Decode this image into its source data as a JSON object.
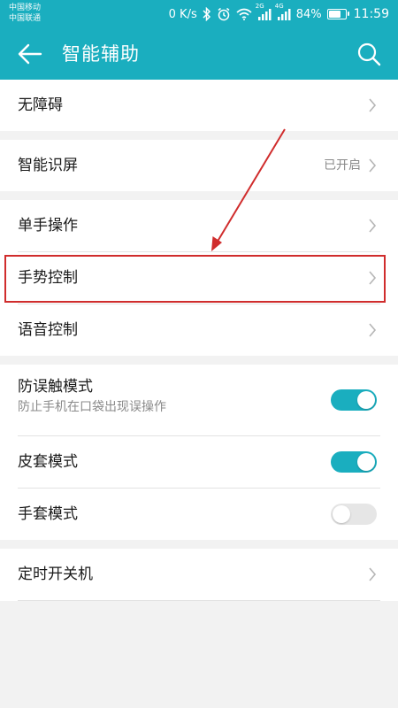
{
  "status": {
    "carrier1": "中国移动",
    "carrier2": "中国联通",
    "speed": "0 K/s",
    "signal1_tag": "2G",
    "signal2_tag": "4G",
    "battery": "84%",
    "time": "11:59"
  },
  "appbar": {
    "title": "智能辅助",
    "back_icon": "back-arrow-icon",
    "search_icon": "search-icon"
  },
  "items": {
    "accessibility": "无障碍",
    "smart_screen": "智能识屏",
    "smart_screen_value": "已开启",
    "one_hand": "单手操作",
    "gesture": "手势控制",
    "voice": "语音控制",
    "pocket_mode": "防误触模式",
    "pocket_mode_desc": "防止手机在口袋出现误操作",
    "cover_mode": "皮套模式",
    "glove_mode": "手套模式",
    "scheduled_power": "定时开关机"
  },
  "toggles": {
    "pocket_mode": true,
    "cover_mode": true,
    "glove_mode": false
  },
  "colors": {
    "accent": "#1aaebf",
    "highlight": "#d02c2c"
  }
}
